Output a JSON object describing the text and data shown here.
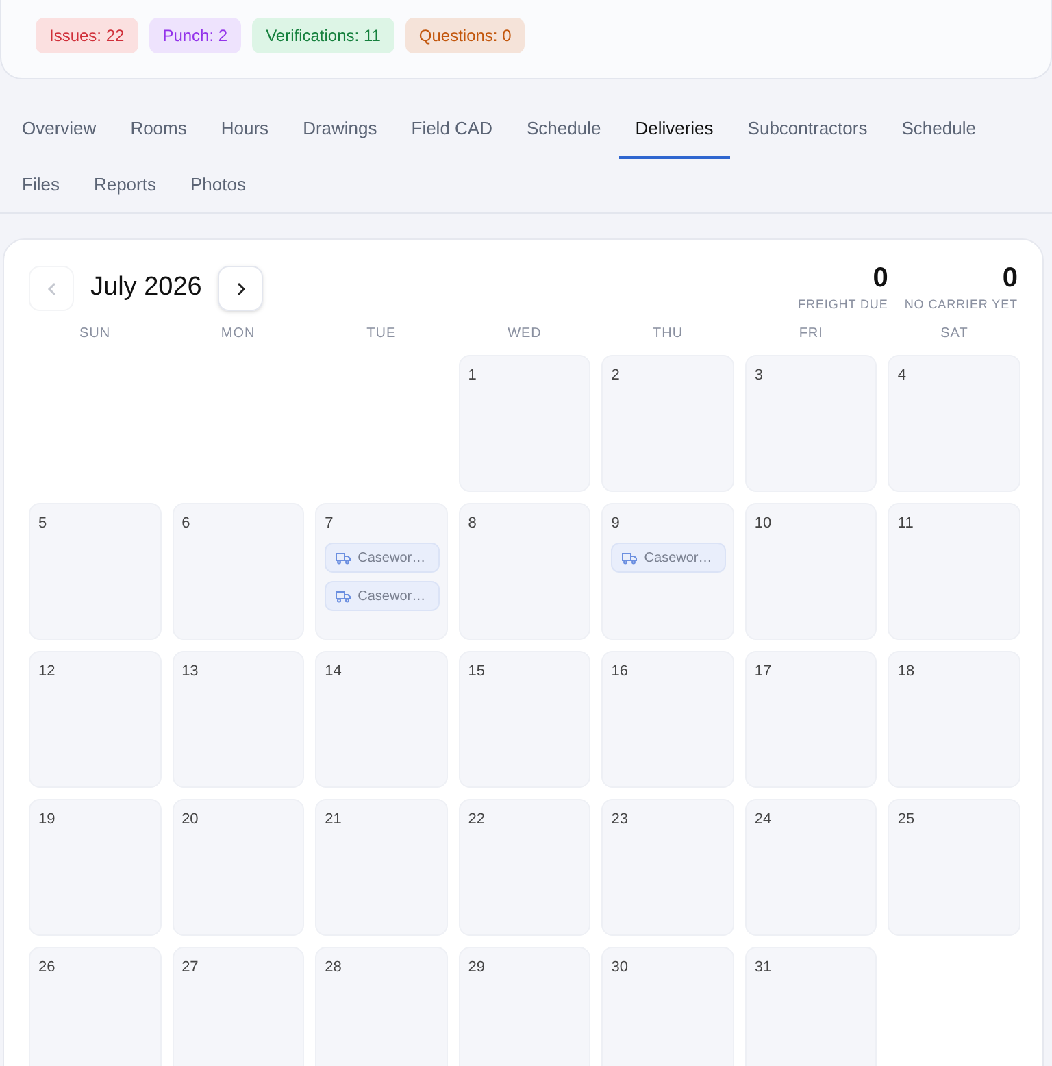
{
  "badges": [
    {
      "label": "Issues: 22",
      "kind": "issues"
    },
    {
      "label": "Punch: 2",
      "kind": "punch"
    },
    {
      "label": "Verifications: 11",
      "kind": "verifications"
    },
    {
      "label": "Questions: 0",
      "kind": "questions"
    }
  ],
  "tabs": [
    {
      "label": "Overview",
      "selected": false
    },
    {
      "label": "Rooms",
      "selected": false
    },
    {
      "label": "Hours",
      "selected": false
    },
    {
      "label": "Drawings",
      "selected": false
    },
    {
      "label": "Field CAD",
      "selected": false
    },
    {
      "label": "Schedule",
      "selected": false
    },
    {
      "label": "Deliveries",
      "selected": true
    },
    {
      "label": "Subcontractors",
      "selected": false
    },
    {
      "label": "Schedule",
      "selected": false
    },
    {
      "label": "Files",
      "selected": false
    },
    {
      "label": "Reports",
      "selected": false
    },
    {
      "label": "Photos",
      "selected": false
    }
  ],
  "calendar": {
    "month": "July 2026",
    "prev_button": {
      "disabled": true
    },
    "next_button": {
      "disabled": false
    },
    "stats": [
      {
        "value": "0",
        "label": "FREIGHT DUE"
      },
      {
        "value": "0",
        "label": "NO CARRIER YET"
      }
    ],
    "weekdays": [
      "SUN",
      "MON",
      "TUE",
      "WED",
      "THU",
      "FRI",
      "SAT"
    ],
    "days": [
      {
        "kind": "blank"
      },
      {
        "kind": "blank"
      },
      {
        "kind": "blank"
      },
      {
        "kind": "day",
        "day": "1"
      },
      {
        "kind": "day",
        "day": "2"
      },
      {
        "kind": "day",
        "day": "3"
      },
      {
        "kind": "day",
        "day": "4"
      },
      {
        "kind": "day",
        "day": "5"
      },
      {
        "kind": "day",
        "day": "6"
      },
      {
        "kind": "day",
        "day": "7",
        "deliveries": [
          "Casewor…",
          "Casewor…"
        ]
      },
      {
        "kind": "day",
        "day": "8"
      },
      {
        "kind": "day",
        "day": "9",
        "deliveries": [
          "Casewor…"
        ]
      },
      {
        "kind": "day",
        "day": "10"
      },
      {
        "kind": "day",
        "day": "11"
      },
      {
        "kind": "day",
        "day": "12"
      },
      {
        "kind": "day",
        "day": "13"
      },
      {
        "kind": "day",
        "day": "14"
      },
      {
        "kind": "day",
        "day": "15"
      },
      {
        "kind": "day",
        "day": "16"
      },
      {
        "kind": "day",
        "day": "17"
      },
      {
        "kind": "day",
        "day": "18"
      },
      {
        "kind": "day",
        "day": "19"
      },
      {
        "kind": "day",
        "day": "20"
      },
      {
        "kind": "day",
        "day": "21"
      },
      {
        "kind": "day",
        "day": "22"
      },
      {
        "kind": "day",
        "day": "23"
      },
      {
        "kind": "day",
        "day": "24"
      },
      {
        "kind": "day",
        "day": "25"
      },
      {
        "kind": "day",
        "day": "26"
      },
      {
        "kind": "day",
        "day": "27"
      },
      {
        "kind": "day",
        "day": "28"
      },
      {
        "kind": "day",
        "day": "29"
      },
      {
        "kind": "day",
        "day": "30"
      },
      {
        "kind": "day",
        "day": "31"
      }
    ]
  }
}
